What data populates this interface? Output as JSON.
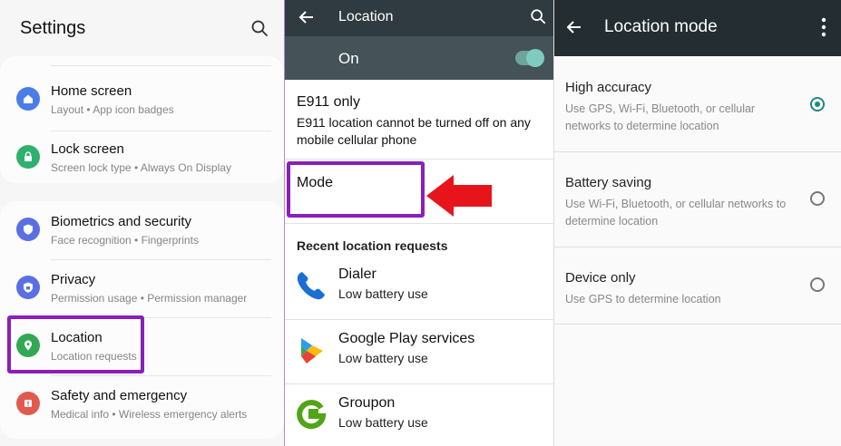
{
  "settings": {
    "title": "Settings",
    "items": [
      {
        "title": "Home screen",
        "subtitle": "Layout  •  App icon badges",
        "icon": "home-icon",
        "color": "#4a7de6"
      },
      {
        "title": "Lock screen",
        "subtitle": "Screen lock type  •  Always On Display",
        "icon": "lock-icon",
        "color": "#2fb06e"
      },
      {
        "title": "Biometrics and security",
        "subtitle": "Face recognition  •  Fingerprints",
        "icon": "shield-icon",
        "color": "#5a70e2"
      },
      {
        "title": "Privacy",
        "subtitle": "Permission usage  •  Permission manager",
        "icon": "privacy-icon",
        "color": "#5a70e2"
      },
      {
        "title": "Location",
        "subtitle": "Location requests",
        "icon": "location-pin-icon",
        "color": "#33a852"
      },
      {
        "title": "Safety and emergency",
        "subtitle": "Medical info  •  Wireless emergency alerts",
        "icon": "alert-icon",
        "color": "#e15a4f"
      }
    ]
  },
  "location": {
    "title": "Location",
    "toggle_label": "On",
    "toggle_on": true,
    "e911_title": "E911 only",
    "e911_subtitle": "E911 location cannot be turned off on any mobile cellular phone",
    "mode_label": "Mode",
    "recent_header": "Recent location requests",
    "apps": [
      {
        "name": "Dialer",
        "usage": "Low battery use",
        "icon": "phone-icon"
      },
      {
        "name": "Google Play services",
        "usage": "Low battery use",
        "icon": "play-services-icon"
      },
      {
        "name": "Groupon",
        "usage": "Low battery use",
        "icon": "groupon-icon"
      }
    ]
  },
  "location_mode": {
    "title": "Location mode",
    "options": [
      {
        "title": "High accuracy",
        "description": "Use GPS, Wi-Fi, Bluetooth, or cellular networks to determine location",
        "selected": true
      },
      {
        "title": "Battery saving",
        "description": "Use Wi-Fi, Bluetooth, or cellular networks to determine location",
        "selected": false
      },
      {
        "title": "Device only",
        "description": "Use GPS to determine location",
        "selected": false
      }
    ]
  },
  "colors": {
    "highlight": "#8a1fbd",
    "arrow": "#e8141b",
    "accent": "#21897c",
    "dark_bar": "#2f3b40"
  }
}
